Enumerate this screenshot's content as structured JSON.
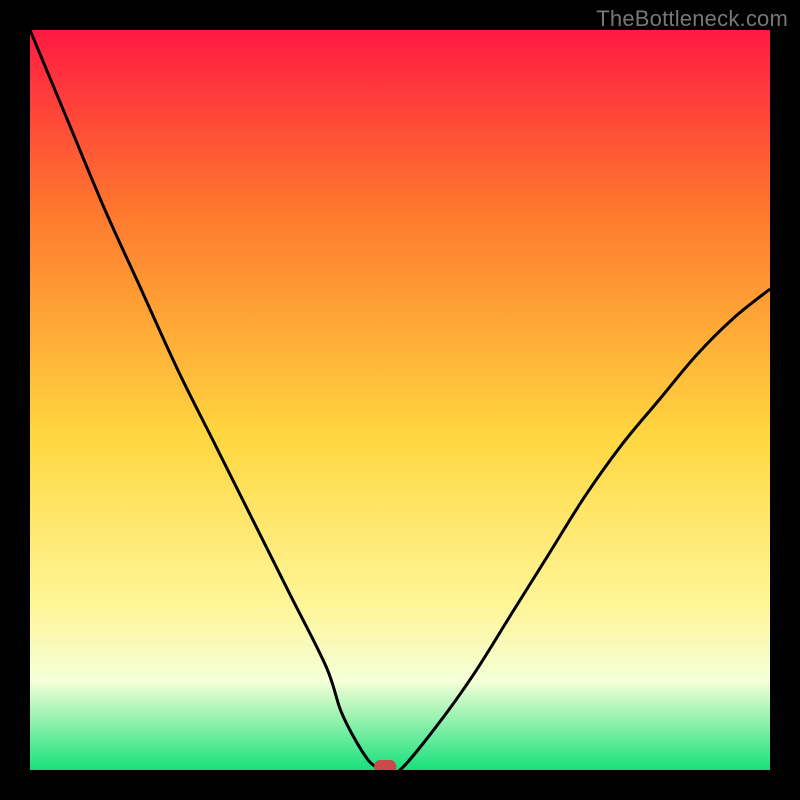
{
  "watermark": "TheBottleneck.com",
  "colors": {
    "top": "#ff1a42",
    "upper_mid": "#ff7a2e",
    "mid": "#ffd740",
    "lower_mid": "#fff69a",
    "pale_band": "#f5ffd8",
    "bottom": "#18e07a",
    "curve": "#000000",
    "marker": "#c94a4a",
    "frame": "#000000"
  },
  "chart_data": {
    "type": "line",
    "title": "",
    "xlabel": "",
    "ylabel": "",
    "xlim": [
      0,
      100
    ],
    "ylim": [
      0,
      100
    ],
    "grid": false,
    "legend": false,
    "series": [
      {
        "name": "bottleneck-curve",
        "x": [
          0,
          5,
          10,
          15,
          20,
          25,
          30,
          35,
          40,
          42,
          44,
          46,
          48,
          50,
          55,
          60,
          65,
          70,
          75,
          80,
          85,
          90,
          95,
          100
        ],
        "y": [
          100,
          88,
          76,
          65,
          54,
          44,
          34,
          24,
          14,
          8,
          4,
          1,
          0,
          0,
          6,
          13,
          21,
          29,
          37,
          44,
          50,
          56,
          61,
          65
        ]
      }
    ],
    "marker": {
      "x": 48,
      "y": 0
    },
    "gradient_stops": [
      {
        "pos": 0,
        "color": "#ff1a42"
      },
      {
        "pos": 25,
        "color": "#ff7a2e"
      },
      {
        "pos": 55,
        "color": "#ffd740"
      },
      {
        "pos": 78,
        "color": "#fff69a"
      },
      {
        "pos": 88,
        "color": "#f5ffd8"
      },
      {
        "pos": 100,
        "color": "#18e07a"
      }
    ]
  }
}
